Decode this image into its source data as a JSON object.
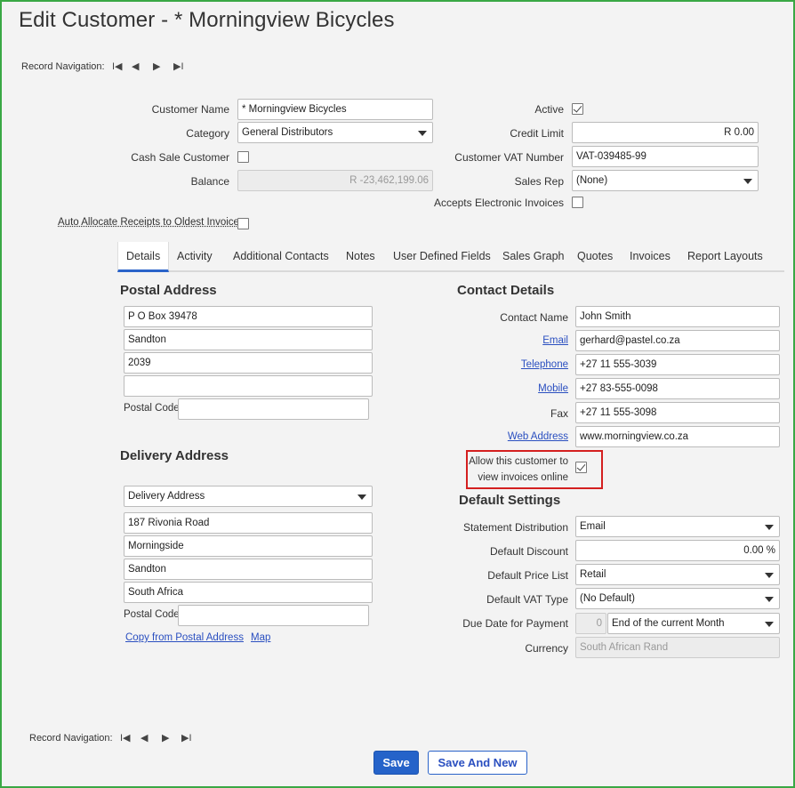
{
  "page": {
    "title": "Edit Customer - * Morningview Bicycles"
  },
  "record_nav": {
    "label": "Record Navigation:",
    "first": "I◀",
    "prev": "◀",
    "next": "▶",
    "last": "▶I"
  },
  "customer": {
    "name_label": "Customer Name",
    "name_value": "* Morningview Bicycles",
    "category_label": "Category",
    "category_value": "General Distributors",
    "cash_sale_label": "Cash Sale Customer",
    "balance_label": "Balance",
    "balance_value": "R -23,462,199.06",
    "auto_allocate_label": "Auto Allocate Receipts to Oldest Invoice",
    "active_label": "Active",
    "credit_limit_label": "Credit Limit",
    "credit_limit_value": "R 0.00",
    "vat_number_label": "Customer VAT Number",
    "vat_number_value": "VAT-039485-99",
    "sales_rep_label": "Sales Rep",
    "sales_rep_value": "(None)",
    "electronic_invoices_label": "Accepts Electronic Invoices"
  },
  "tabs": [
    {
      "label": "Details"
    },
    {
      "label": "Activity"
    },
    {
      "label": "Additional Contacts"
    },
    {
      "label": "Notes"
    },
    {
      "label": "User Defined Fields"
    },
    {
      "label": "Sales Graph"
    },
    {
      "label": "Quotes"
    },
    {
      "label": "Invoices"
    },
    {
      "label": "Report Layouts"
    }
  ],
  "postal": {
    "title": "Postal Address",
    "line1": "P O Box 39478",
    "line2": "Sandton",
    "line3": "2039",
    "line4": "",
    "postal_code_label": "Postal Code",
    "postal_code_value": ""
  },
  "delivery": {
    "title": "Delivery Address",
    "select_value": "Delivery Address",
    "line1": "187 Rivonia Road",
    "line2": "Morningside",
    "line3": "Sandton",
    "line4": "South Africa",
    "postal_code_label": "Postal Code",
    "postal_code_value": "",
    "copy_link": "Copy from Postal Address",
    "map_link": "Map"
  },
  "contact": {
    "title": "Contact Details",
    "name_label": "Contact Name",
    "name_value": "John Smith",
    "email_label": "Email",
    "email_value": "gerhard@pastel.co.za",
    "telephone_label": "Telephone",
    "telephone_value": "+27 11 555-3039",
    "mobile_label": "Mobile",
    "mobile_value": "+27 83-555-0098",
    "fax_label": "Fax",
    "fax_value": "+27 11 555-3098",
    "web_label": "Web Address",
    "web_value": "www.morningview.co.za",
    "allow_online_line1": "Allow this customer to",
    "allow_online_line2": "view invoices online"
  },
  "defaults": {
    "title": "Default Settings",
    "statement_label": "Statement Distribution",
    "statement_value": "Email",
    "discount_label": "Default Discount",
    "discount_value": "0.00 %",
    "price_list_label": "Default Price List",
    "price_list_value": "Retail",
    "vat_type_label": "Default VAT Type",
    "vat_type_value": "(No Default)",
    "due_date_label": "Due Date for Payment",
    "due_days_value": "0",
    "due_date_value": "End of the current Month",
    "currency_label": "Currency",
    "currency_value": "South African Rand"
  },
  "footer": {
    "save": "Save",
    "save_new": "Save And New"
  }
}
